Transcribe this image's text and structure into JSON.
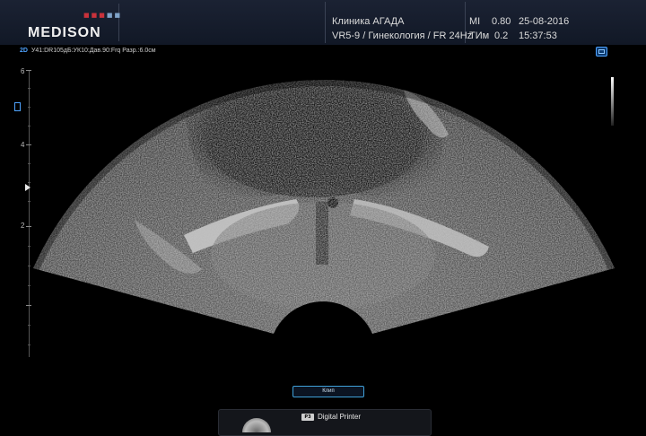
{
  "header": {
    "brand": "MEDISON",
    "brand_dot_colors": [
      "#c9323b",
      "#c9323b",
      "#c9323b",
      "#7fa3c8",
      "#7fa3c8"
    ],
    "clinic_name": "Клиника АГАДА",
    "probe_preset": "VR5-9 / Гинекология / FR 24Hz",
    "mi_label": "MI",
    "mi_value": "0.80",
    "tim_label": "ТИм",
    "tim_value": "0.2",
    "date": "25-08-2016",
    "time": "15:37:53"
  },
  "params": {
    "mode": "2D",
    "text": "У41:DR105дБ:УК10:Дав.90:Frq Разр.:6.0см"
  },
  "depth_scale": {
    "labels": [
      "6",
      "4",
      "2"
    ]
  },
  "controls": {
    "clip_button_label": "Клип",
    "printer_badge": "P3",
    "printer_label": "Digital Printer"
  },
  "colors": {
    "accent": "#3fa0d8",
    "header_bg": "#1b2233"
  }
}
